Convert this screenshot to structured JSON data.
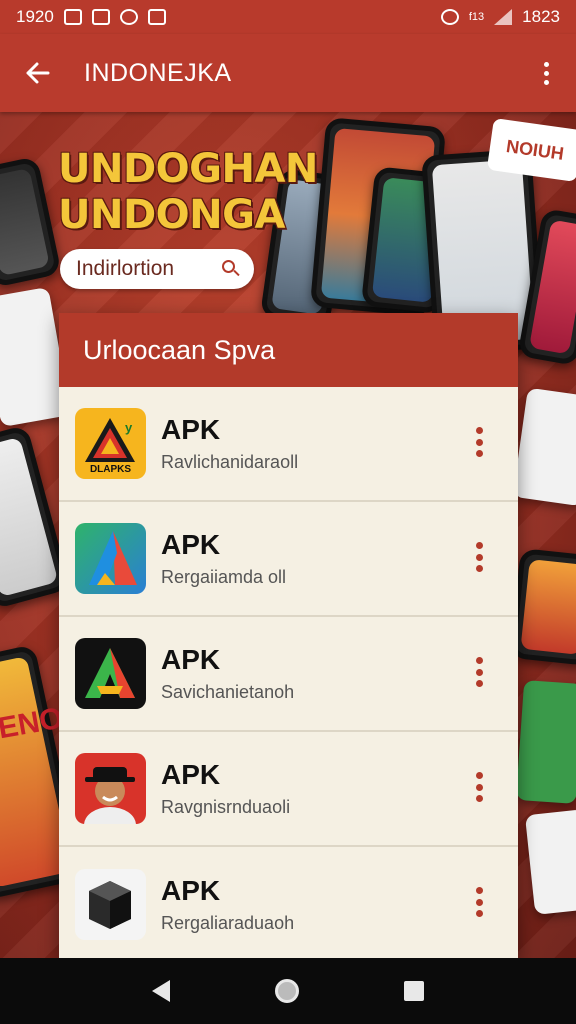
{
  "status_bar": {
    "time_left": "1920",
    "time_right": "1823",
    "signal_label": "f13"
  },
  "app_bar": {
    "title": "INDONEJKA"
  },
  "hero": {
    "headline_line1": "UNDOGHAN",
    "headline_line2": "UNDONGA",
    "search_label": "Indirlortion",
    "badge_text": "NOIUH",
    "side_banner_text": "ENO"
  },
  "panel": {
    "header": "Urloocaan Spva",
    "items": [
      {
        "title": "APK",
        "subtitle": "Ravlichanidaraoll",
        "icon_caption": "DLAPKS",
        "icon": "triangle-logo-yellow-icon"
      },
      {
        "title": "APK",
        "subtitle": "Rergaiiamda oll",
        "icon_caption": "",
        "icon": "android-studio-style-icon"
      },
      {
        "title": "APK",
        "subtitle": "Savichanietanoh",
        "icon_caption": "",
        "icon": "green-a-logo-icon"
      },
      {
        "title": "APK",
        "subtitle": "Ravgnisrnduaoli",
        "icon_caption": "",
        "icon": "person-hat-avatar-icon"
      },
      {
        "title": "APK",
        "subtitle": "Rergaliaraduaoh",
        "icon_caption": "",
        "icon": "black-cube-icon"
      }
    ]
  },
  "colors": {
    "brand_red": "#b33a2a",
    "headline_yellow": "#f4c63a",
    "panel_bg": "#f5f0e3"
  }
}
